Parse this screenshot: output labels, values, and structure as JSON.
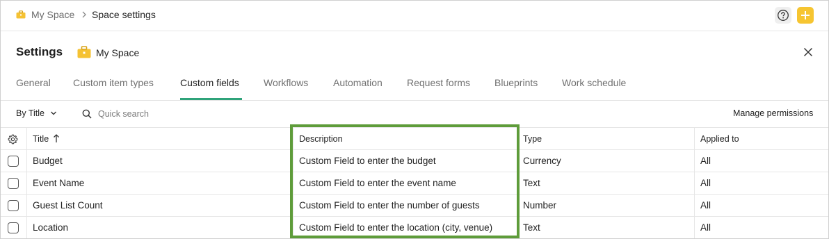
{
  "breadcrumb": {
    "space": "My Space",
    "current": "Space settings"
  },
  "header": {
    "title": "Settings",
    "space_name": "My Space"
  },
  "tabs": [
    {
      "label": "General",
      "active": false
    },
    {
      "label": "Custom item types",
      "active": false
    },
    {
      "label": "Custom fields",
      "active": true
    },
    {
      "label": "Workflows",
      "active": false
    },
    {
      "label": "Automation",
      "active": false
    },
    {
      "label": "Request forms",
      "active": false
    },
    {
      "label": "Blueprints",
      "active": false
    },
    {
      "label": "Work schedule",
      "active": false
    }
  ],
  "toolbar": {
    "sort_label": "By Title",
    "search_placeholder": "Quick search",
    "manage_permissions": "Manage permissions"
  },
  "table": {
    "columns": [
      "Title",
      "Description",
      "Type",
      "Applied to"
    ],
    "rows": [
      {
        "title": "Budget",
        "description": "Custom Field to enter the budget",
        "type": "Currency",
        "applied_to": "All"
      },
      {
        "title": "Event Name",
        "description": "Custom Field to enter the event name",
        "type": "Text",
        "applied_to": "All"
      },
      {
        "title": "Guest List Count",
        "description": "Custom Field to enter the number of guests",
        "type": "Number",
        "applied_to": "All"
      },
      {
        "title": "Location",
        "description": "Custom Field to enter the location (city, venue)",
        "type": "Text",
        "applied_to": "All"
      }
    ]
  },
  "colors": {
    "accent": "#2fa37a",
    "highlight": "#5e9c3a",
    "add_button": "#f6c531"
  }
}
